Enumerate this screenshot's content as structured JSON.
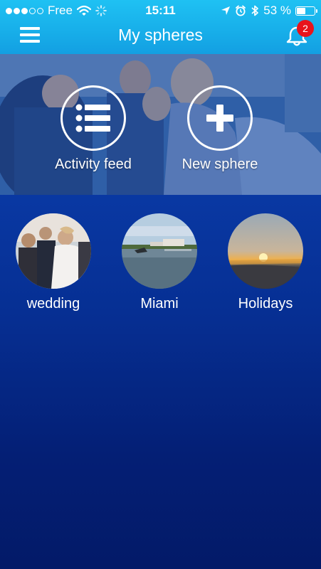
{
  "status_bar": {
    "carrier": "Free",
    "time": "15:11",
    "battery": "53 %",
    "battery_level": 0.53,
    "signal_bars_filled": 3,
    "signal_bars_total": 5,
    "icons": [
      "wifi-icon",
      "loading-icon",
      "location-arrow-icon",
      "alarm-icon",
      "bluetooth-icon",
      "battery-icon"
    ]
  },
  "navbar": {
    "title": "My spheres",
    "menu_icon": "hamburger-menu-icon",
    "notifications_icon": "bell-icon",
    "notification_count": "2"
  },
  "hero": {
    "actions": [
      {
        "label": "Activity feed",
        "icon": "list-icon"
      },
      {
        "label": "New sphere",
        "icon": "plus-icon"
      }
    ]
  },
  "spheres": [
    {
      "label": "wedding",
      "image": "wedding-photo"
    },
    {
      "label": "Miami",
      "image": "miami-waterfront-photo"
    },
    {
      "label": "Holidays",
      "image": "sunset-beach-photo"
    }
  ],
  "colors": {
    "navbar": "#17aee9",
    "background_top": "#1153c4",
    "background_bottom": "#031a68",
    "badge": "#e8141b"
  }
}
